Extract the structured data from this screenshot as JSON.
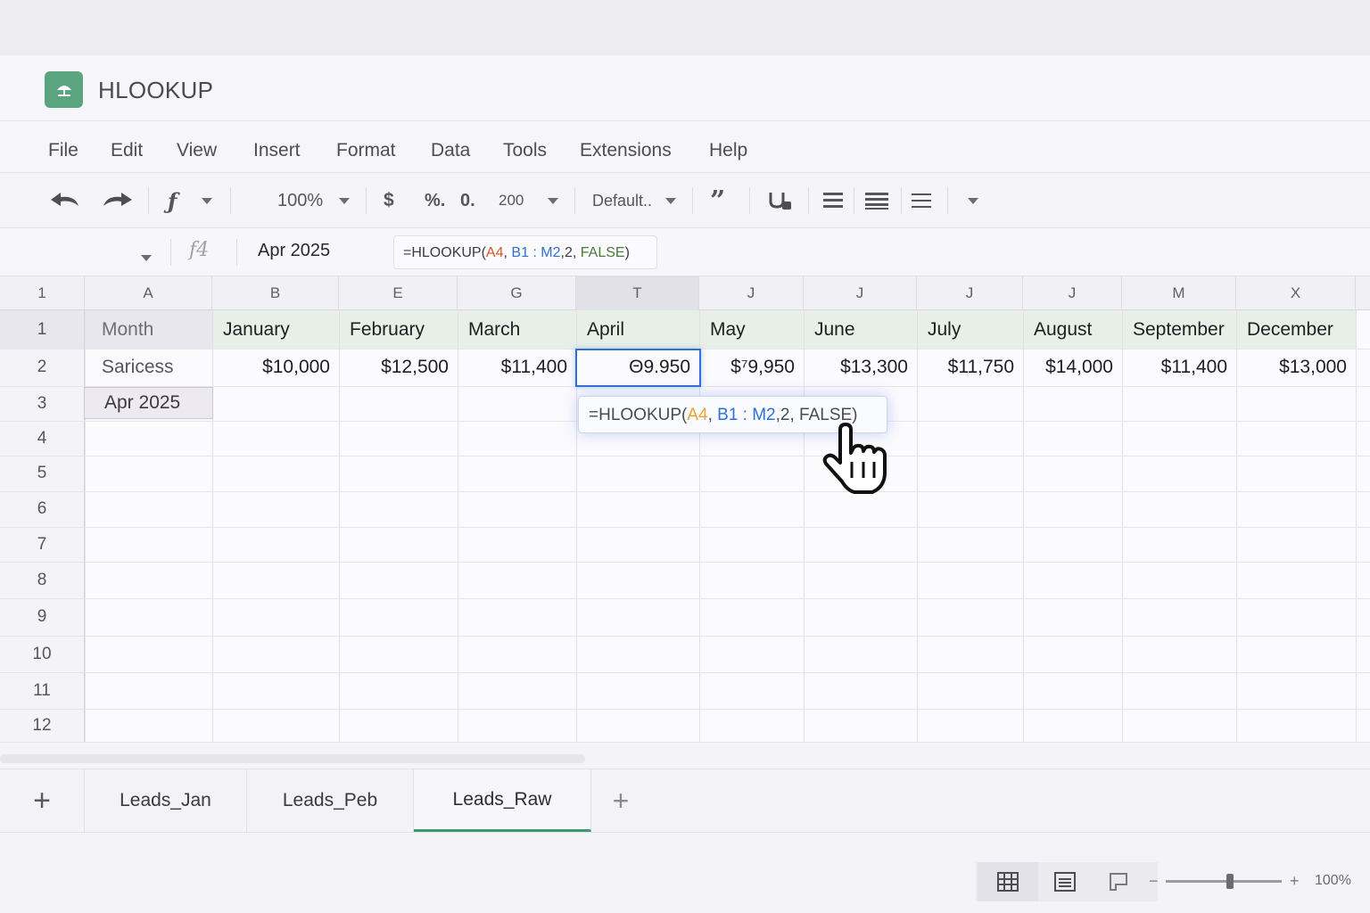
{
  "app": {
    "title": "HLOOKUP"
  },
  "menu": [
    "File",
    "Edit",
    "View",
    "Insert",
    "Format",
    "Data",
    "Tools",
    "Extensions",
    "Help"
  ],
  "toolbar": {
    "zoom": "100%",
    "currency": "$",
    "percent": "%.",
    "decimal": "0.",
    "more_formats": "200",
    "font": "Default.."
  },
  "formula_bar": {
    "fx_label": "f4",
    "cell_value": "Apr 2025",
    "formula_parts": [
      {
        "text": "=HLOOKUP(",
        "color": "#3c3c40"
      },
      {
        "text": "A4",
        "color": "#d4582b"
      },
      {
        "text": ", ",
        "color": "#3c3c40"
      },
      {
        "text": "B1 : M2",
        "color": "#2f6fd6"
      },
      {
        "text": ",2, ",
        "color": "#3c3c40"
      },
      {
        "text": "FALSE",
        "color": "#4a7a3a"
      },
      {
        "text": ")",
        "color": "#3c3c40"
      }
    ]
  },
  "grid": {
    "corner": "1",
    "columns": [
      "A",
      "B",
      "E",
      "G",
      "T",
      "J",
      "J",
      "J",
      "J",
      "M",
      "X"
    ],
    "rows": [
      "1",
      "2",
      "3",
      "4",
      "5",
      "6",
      "7",
      "8",
      "9",
      "10",
      "11",
      "12"
    ],
    "header_row": [
      "Month",
      "January",
      "February",
      "March",
      "April",
      "May",
      "June",
      "July",
      "August",
      "September",
      "December"
    ],
    "data_row": [
      "Saricess",
      "$10,000",
      "$12,500",
      "$11,400",
      "Θ9.950",
      "$⁷9,950",
      "$13,300",
      "$11,750",
      "$14,000",
      "$11,400",
      "$13,000"
    ],
    "lookup_cell": "Apr 2025"
  },
  "tooltip": {
    "parts": [
      {
        "text": "=HLOOKUP(",
        "color": "#4a4a55"
      },
      {
        "text": "A4",
        "color": "#e8a234"
      },
      {
        "text": ", ",
        "color": "#4a4a55"
      },
      {
        "text": "B1 : M2",
        "color": "#2f6fd6"
      },
      {
        "text": ",2, FALSE)",
        "color": "#4a4a55"
      }
    ]
  },
  "sheets": {
    "add_label": "+",
    "tabs": [
      "Leads_Jan",
      "Leads_Peb",
      "Leads_Raw"
    ],
    "active": 2
  },
  "status": {
    "zoom": "100%",
    "zoom_level": 0.55
  },
  "colors": {
    "accent": "#3f9a74",
    "header_fill": "#e7efe6",
    "selection": "#2f6fd6"
  }
}
